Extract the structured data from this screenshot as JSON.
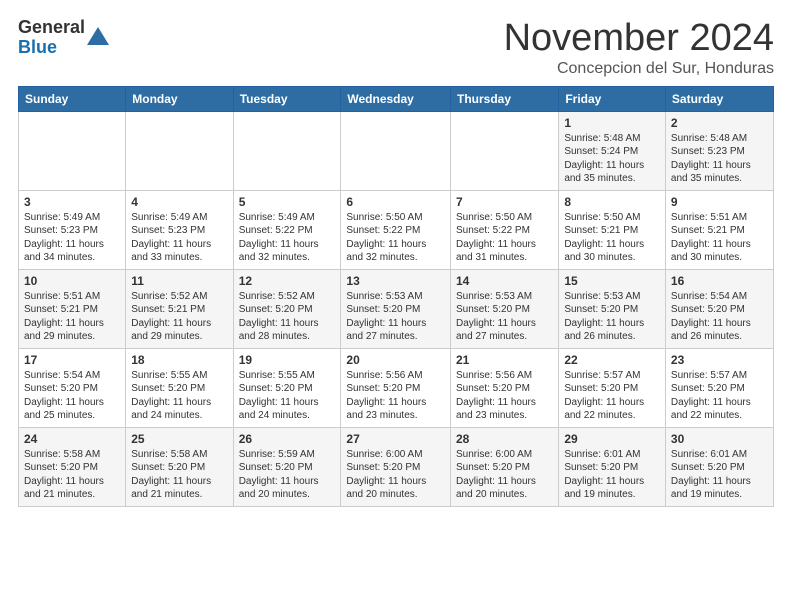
{
  "logo": {
    "general": "General",
    "blue": "Blue"
  },
  "title": "November 2024",
  "subtitle": "Concepcion del Sur, Honduras",
  "days": [
    "Sunday",
    "Monday",
    "Tuesday",
    "Wednesday",
    "Thursday",
    "Friday",
    "Saturday"
  ],
  "weeks": [
    [
      {
        "day": "",
        "content": ""
      },
      {
        "day": "",
        "content": ""
      },
      {
        "day": "",
        "content": ""
      },
      {
        "day": "",
        "content": ""
      },
      {
        "day": "",
        "content": ""
      },
      {
        "day": "1",
        "content": "Sunrise: 5:48 AM\nSunset: 5:24 PM\nDaylight: 11 hours\nand 35 minutes."
      },
      {
        "day": "2",
        "content": "Sunrise: 5:48 AM\nSunset: 5:23 PM\nDaylight: 11 hours\nand 35 minutes."
      }
    ],
    [
      {
        "day": "3",
        "content": "Sunrise: 5:49 AM\nSunset: 5:23 PM\nDaylight: 11 hours\nand 34 minutes."
      },
      {
        "day": "4",
        "content": "Sunrise: 5:49 AM\nSunset: 5:23 PM\nDaylight: 11 hours\nand 33 minutes."
      },
      {
        "day": "5",
        "content": "Sunrise: 5:49 AM\nSunset: 5:22 PM\nDaylight: 11 hours\nand 32 minutes."
      },
      {
        "day": "6",
        "content": "Sunrise: 5:50 AM\nSunset: 5:22 PM\nDaylight: 11 hours\nand 32 minutes."
      },
      {
        "day": "7",
        "content": "Sunrise: 5:50 AM\nSunset: 5:22 PM\nDaylight: 11 hours\nand 31 minutes."
      },
      {
        "day": "8",
        "content": "Sunrise: 5:50 AM\nSunset: 5:21 PM\nDaylight: 11 hours\nand 30 minutes."
      },
      {
        "day": "9",
        "content": "Sunrise: 5:51 AM\nSunset: 5:21 PM\nDaylight: 11 hours\nand 30 minutes."
      }
    ],
    [
      {
        "day": "10",
        "content": "Sunrise: 5:51 AM\nSunset: 5:21 PM\nDaylight: 11 hours\nand 29 minutes."
      },
      {
        "day": "11",
        "content": "Sunrise: 5:52 AM\nSunset: 5:21 PM\nDaylight: 11 hours\nand 29 minutes."
      },
      {
        "day": "12",
        "content": "Sunrise: 5:52 AM\nSunset: 5:20 PM\nDaylight: 11 hours\nand 28 minutes."
      },
      {
        "day": "13",
        "content": "Sunrise: 5:53 AM\nSunset: 5:20 PM\nDaylight: 11 hours\nand 27 minutes."
      },
      {
        "day": "14",
        "content": "Sunrise: 5:53 AM\nSunset: 5:20 PM\nDaylight: 11 hours\nand 27 minutes."
      },
      {
        "day": "15",
        "content": "Sunrise: 5:53 AM\nSunset: 5:20 PM\nDaylight: 11 hours\nand 26 minutes."
      },
      {
        "day": "16",
        "content": "Sunrise: 5:54 AM\nSunset: 5:20 PM\nDaylight: 11 hours\nand 26 minutes."
      }
    ],
    [
      {
        "day": "17",
        "content": "Sunrise: 5:54 AM\nSunset: 5:20 PM\nDaylight: 11 hours\nand 25 minutes."
      },
      {
        "day": "18",
        "content": "Sunrise: 5:55 AM\nSunset: 5:20 PM\nDaylight: 11 hours\nand 24 minutes."
      },
      {
        "day": "19",
        "content": "Sunrise: 5:55 AM\nSunset: 5:20 PM\nDaylight: 11 hours\nand 24 minutes."
      },
      {
        "day": "20",
        "content": "Sunrise: 5:56 AM\nSunset: 5:20 PM\nDaylight: 11 hours\nand 23 minutes."
      },
      {
        "day": "21",
        "content": "Sunrise: 5:56 AM\nSunset: 5:20 PM\nDaylight: 11 hours\nand 23 minutes."
      },
      {
        "day": "22",
        "content": "Sunrise: 5:57 AM\nSunset: 5:20 PM\nDaylight: 11 hours\nand 22 minutes."
      },
      {
        "day": "23",
        "content": "Sunrise: 5:57 AM\nSunset: 5:20 PM\nDaylight: 11 hours\nand 22 minutes."
      }
    ],
    [
      {
        "day": "24",
        "content": "Sunrise: 5:58 AM\nSunset: 5:20 PM\nDaylight: 11 hours\nand 21 minutes."
      },
      {
        "day": "25",
        "content": "Sunrise: 5:58 AM\nSunset: 5:20 PM\nDaylight: 11 hours\nand 21 minutes."
      },
      {
        "day": "26",
        "content": "Sunrise: 5:59 AM\nSunset: 5:20 PM\nDaylight: 11 hours\nand 20 minutes."
      },
      {
        "day": "27",
        "content": "Sunrise: 6:00 AM\nSunset: 5:20 PM\nDaylight: 11 hours\nand 20 minutes."
      },
      {
        "day": "28",
        "content": "Sunrise: 6:00 AM\nSunset: 5:20 PM\nDaylight: 11 hours\nand 20 minutes."
      },
      {
        "day": "29",
        "content": "Sunrise: 6:01 AM\nSunset: 5:20 PM\nDaylight: 11 hours\nand 19 minutes."
      },
      {
        "day": "30",
        "content": "Sunrise: 6:01 AM\nSunset: 5:20 PM\nDaylight: 11 hours\nand 19 minutes."
      }
    ]
  ]
}
